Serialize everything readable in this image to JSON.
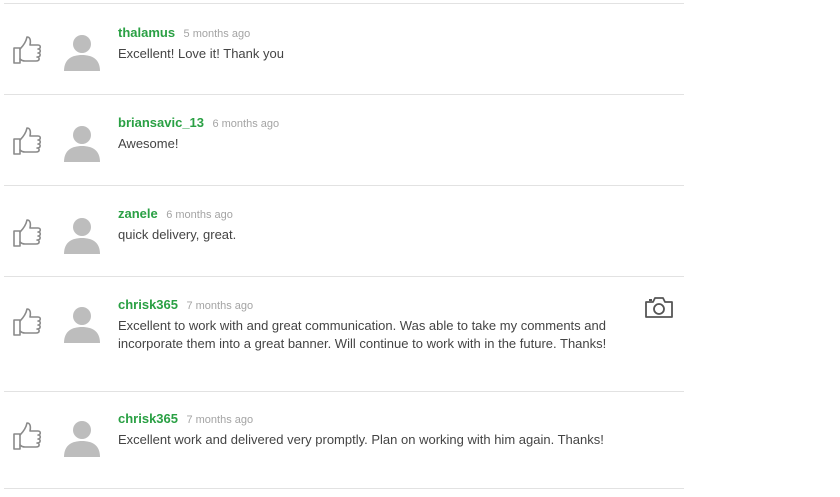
{
  "reviews": [
    {
      "username": "thalamus",
      "time": "5 months ago",
      "text": "Excellent! Love it! Thank you",
      "icons": [
        "thumbs-up-icon",
        "avatar-icon"
      ]
    },
    {
      "username": "briansavic_13",
      "time": "6 months ago",
      "text": "Awesome!",
      "icons": [
        "thumbs-up-icon",
        "avatar-icon"
      ]
    },
    {
      "username": "zanele",
      "time": "6 months ago",
      "text": "quick delivery, great.",
      "icons": [
        "thumbs-up-icon",
        "avatar-icon"
      ]
    },
    {
      "username": "chrisk365",
      "time": "7 months ago",
      "text": "Excellent to work with and great communication. Was able to take my comments and incorporate them into a great banner. Will continue to work with in the future. Thanks!",
      "icons": [
        "thumbs-up-icon",
        "avatar-icon",
        "camera-icon"
      ]
    },
    {
      "username": "chrisk365",
      "time": "7 months ago",
      "text": "Excellent work and delivered very promptly. Plan on working with him again. Thanks!",
      "icons": [
        "thumbs-up-icon",
        "avatar-icon"
      ]
    }
  ],
  "colors": {
    "username": "#2aa044",
    "time": "#a4a4a4",
    "text": "#444444",
    "divider": "#e2e2e2",
    "icon": "#bdbdbd"
  }
}
